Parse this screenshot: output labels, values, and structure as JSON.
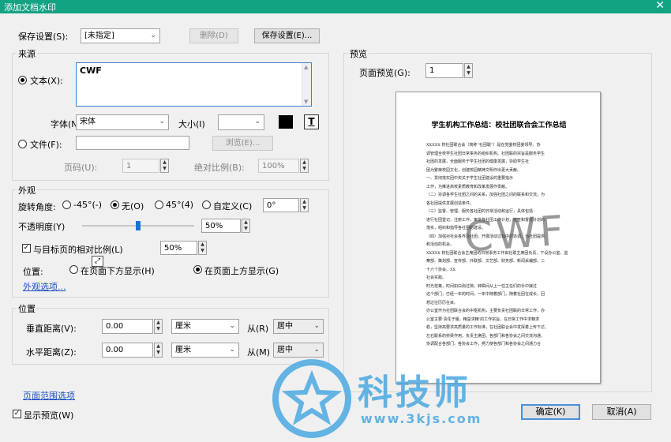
{
  "window": {
    "title": "添加文档水印",
    "close_glyph": "✕"
  },
  "save_settings": {
    "label": "保存设置(S):",
    "value": "[未指定]",
    "delete_label": "删除(D)",
    "save_label": "保存设置(E)..."
  },
  "source": {
    "group_title": "来源",
    "text_radio_label": "文本(X):",
    "text_value": "CWF",
    "font_label": "字体(N):",
    "font_value": "宋体",
    "size_label": "大小(I)",
    "size_value": "",
    "text_color": "#000000",
    "text_format_glyph": "T",
    "file_radio_label": "文件(F):",
    "file_value": "",
    "browse_label": "浏览(E)...",
    "page_label": "页码(U):",
    "page_value": "1",
    "abs_scale_label": "绝对比例(B):",
    "abs_scale_value": "100%"
  },
  "appearance": {
    "group_title": "外观",
    "rotation_label": "旋转角度:",
    "rotation_options": [
      "-45°(-)",
      "无(O)",
      "45°(4)",
      "自定义(C)"
    ],
    "rotation_selected": "无(O)",
    "custom_angle_value": "0°",
    "opacity_label": "不透明度(Y)",
    "opacity_value": "50%",
    "opacity_fraction": 0.5,
    "relative_scale_label": "与目标页的相对比例(L)",
    "relative_scale_value": "50%",
    "position_label": "位置:",
    "position_options": [
      "在页面下方显示(H)",
      "在页面上方显示(G)"
    ],
    "position_selected": "在页面上方显示(G)",
    "appearance_options_link": "外观选项..."
  },
  "position": {
    "group_title": "位置",
    "vertical_label": "垂直距离(V):",
    "vertical_value": "0.00",
    "vertical_unit": "厘米",
    "vertical_from_label": "从(R)",
    "vertical_from_value": "居中",
    "horizontal_label": "水平距离(Z):",
    "horizontal_value": "0.00",
    "horizontal_unit": "厘米",
    "horizontal_from_label": "从(M)",
    "horizontal_from_value": "居中"
  },
  "page_range_link": "页面范围选项",
  "show_preview_label": "显示预览(W)",
  "preview": {
    "group_title": "预览",
    "page_preview_label": "页面预览(G):",
    "page_preview_value": "1",
    "doc_title": "学生机构工作总结：校社团联合会工作总结",
    "watermark_text": "CWF",
    "page_text": [
      "XXXXX 校社团联合会（简称“社团联”）是在党委校团委领导、协",
      "调管理全校学生社团日常事务的组织机构。社团联的宗旨是服务学生",
      "社团的发展，全面服务于学生社团的健康发展，协助学生社",
      "团为繁荣校园文化，创建校园精神文明作出更大贡献。",
      "一、贯彻落实团中央关于学生社团建设的重要指示",
      "工作，为推进高校素质教育和改革发展作贡献。",
      "（二）协调各学生社团之间的关系，加强社团之间的联系和交流，为",
      "各社团提供发展创造条件。",
      "（三）监督、管理、服务各社团的日常活动和运行，具体包括：",
      "进行社团登记、注册工作，审批各社团工作计划，检查和督促计划的",
      "落实，组织和指导各社团的建设。",
      "（四）加强对社会各界及社团，开展活动过程中的协调，为社团提供",
      "和活动的机会。",
      "XXXXX 校社团联合会主席团的日常事务工作由社联主席团负责，下设办公室、监",
      "察部、策划部、宣传部、外联部、文艺部、财务部、新闻采编部。二",
      "十六个协会。XX",
      "社会实践。",
      "时光荏苒，时间如白驹过隙，转瞬间从上一任主任们的手中接过",
      "这个部门，已经一年的时间，一年中随着部门，随着社团在成长，回",
      "想过往历历在目。",
      "办公室作为社团联合会的中枢机构，主要负责社团联的日常工作，办",
      "公室主要‘责任于服，精益求精’的工作宗旨，在日常工作中求精求",
      "稳，坚持高要求高质量的工作标准，在社团联合会中发挥着上传下达、",
      "左右联系的桥梁作用，负责主席团、各部门和各协会之间交流沟通，",
      "协调配合各部门、各协会工作，努力使各部门和各协会之间通力合"
    ]
  },
  "buttons": {
    "ok_label": "确定(K)",
    "cancel_label": "取消(A)"
  },
  "brand": {
    "name": "科技师",
    "url": "www.3kjs.com",
    "color": "#4aa8e0"
  }
}
